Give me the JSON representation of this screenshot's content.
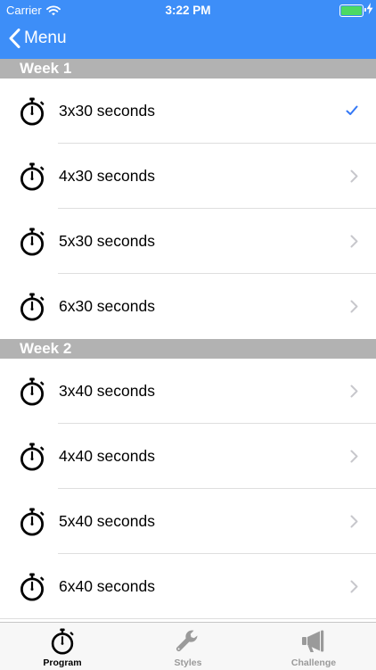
{
  "status": {
    "carrier": "Carrier",
    "time": "3:22 PM"
  },
  "nav": {
    "back_label": "Menu"
  },
  "sections": [
    {
      "title": "Week 1",
      "items": [
        {
          "label": "3x30 seconds",
          "accessory": "checkmark"
        },
        {
          "label": "4x30 seconds",
          "accessory": "chevron"
        },
        {
          "label": "5x30 seconds",
          "accessory": "chevron"
        },
        {
          "label": "6x30 seconds",
          "accessory": "chevron"
        }
      ]
    },
    {
      "title": "Week 2",
      "items": [
        {
          "label": "3x40 seconds",
          "accessory": "chevron"
        },
        {
          "label": "4x40 seconds",
          "accessory": "chevron"
        },
        {
          "label": "5x40 seconds",
          "accessory": "chevron"
        },
        {
          "label": "6x40 seconds",
          "accessory": "chevron"
        }
      ]
    }
  ],
  "tabbar": {
    "tabs": [
      {
        "label": "Program",
        "icon": "stopwatch-icon",
        "selected": true
      },
      {
        "label": "Styles",
        "icon": "wrench-icon",
        "selected": false
      },
      {
        "label": "Challenge",
        "icon": "megaphone-icon",
        "selected": false
      }
    ]
  },
  "colors": {
    "nav_bar": "#3d8ef8",
    "section_header": "#b2b2b2",
    "checkmark": "#3478f6",
    "chevron": "#c7c7cc",
    "tab_selected": "#000000",
    "tab_unselected": "#9a9a9a"
  }
}
